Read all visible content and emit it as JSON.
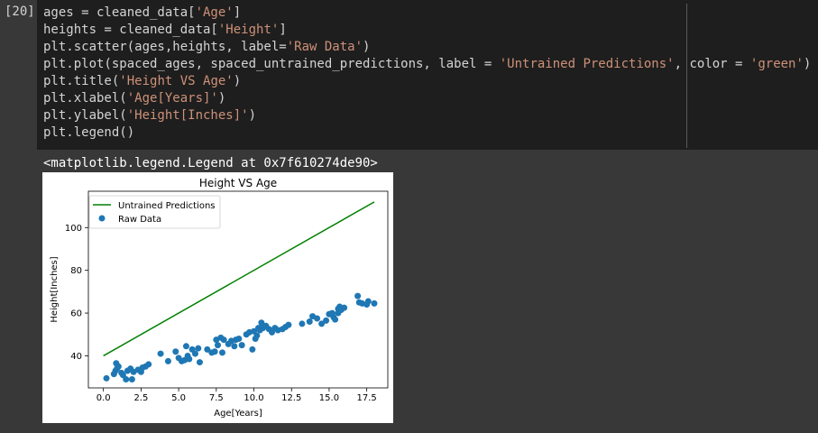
{
  "cell": {
    "prompt": "[20]",
    "code_lines": [
      [
        {
          "t": "ages = cleaned_data["
        },
        {
          "t": "'Age'",
          "s": 1
        },
        {
          "t": "]"
        }
      ],
      [
        {
          "t": "heights = cleaned_data["
        },
        {
          "t": "'Height'",
          "s": 1
        },
        {
          "t": "]"
        }
      ],
      [
        {
          "t": "plt.scatter(ages,heights, label="
        },
        {
          "t": "'Raw Data'",
          "s": 1
        },
        {
          "t": ")"
        }
      ],
      [
        {
          "t": "plt.plot(spaced_ages, spaced_untrained_predictions, label = "
        },
        {
          "t": "'Untrained Predictions'",
          "s": 1
        },
        {
          "t": ", color = "
        },
        {
          "t": "'green'",
          "s": 1
        },
        {
          "t": ")"
        }
      ],
      [
        {
          "t": "plt.title("
        },
        {
          "t": "'Height VS Age'",
          "s": 1
        },
        {
          "t": ")"
        }
      ],
      [
        {
          "t": "plt.xlabel("
        },
        {
          "t": "'Age[Years]'",
          "s": 1
        },
        {
          "t": ")"
        }
      ],
      [
        {
          "t": "plt.ylabel("
        },
        {
          "t": "'Height[Inches]'",
          "s": 1
        },
        {
          "t": ")"
        }
      ],
      [
        {
          "t": "plt.legend()"
        }
      ]
    ]
  },
  "output": {
    "text": "<matplotlib.legend.Legend at 0x7f610274de90>"
  },
  "chart_data": {
    "type": "scatter",
    "title": "Height VS Age",
    "xlabel": "Age[Years]",
    "ylabel": "Height[Inches]",
    "xlim": [
      -1.0,
      18.9
    ],
    "ylim": [
      25,
      117
    ],
    "xticks": [
      0.0,
      2.5,
      5.0,
      7.5,
      10.0,
      12.5,
      15.0,
      17.5
    ],
    "xtick_labels": [
      "0.0",
      "2.5",
      "5.0",
      "7.5",
      "10.0",
      "12.5",
      "15.0",
      "17.5"
    ],
    "yticks": [
      40,
      60,
      80,
      100
    ],
    "ytick_labels": [
      "40",
      "60",
      "80",
      "100"
    ],
    "legend_position": "top-left",
    "line_series": {
      "name": "Untrained Predictions",
      "color": "#008000",
      "x": [
        0.0,
        18.0
      ],
      "y": [
        40,
        112
      ]
    },
    "scatter_series": {
      "name": "Raw Data",
      "color": "#1f77b4",
      "points": [
        [
          0.2,
          29.5
        ],
        [
          0.7,
          31.5
        ],
        [
          0.8,
          33
        ],
        [
          0.9,
          34
        ],
        [
          0.85,
          36.5
        ],
        [
          1.0,
          35
        ],
        [
          1.2,
          32
        ],
        [
          1.3,
          31
        ],
        [
          1.5,
          29
        ],
        [
          1.6,
          33
        ],
        [
          1.8,
          34
        ],
        [
          1.9,
          29
        ],
        [
          2.0,
          32.5
        ],
        [
          2.3,
          33.5
        ],
        [
          2.5,
          32.5
        ],
        [
          2.6,
          34.5
        ],
        [
          2.8,
          35
        ],
        [
          3.0,
          36
        ],
        [
          3.8,
          41
        ],
        [
          4.3,
          37.5
        ],
        [
          4.8,
          42
        ],
        [
          5.0,
          39
        ],
        [
          5.2,
          37.5
        ],
        [
          5.4,
          38
        ],
        [
          5.5,
          44.5
        ],
        [
          5.6,
          40
        ],
        [
          5.7,
          38.5
        ],
        [
          5.9,
          43
        ],
        [
          6.1,
          41
        ],
        [
          6.3,
          43.5
        ],
        [
          6.4,
          37
        ],
        [
          6.9,
          43
        ],
        [
          7.2,
          41.5
        ],
        [
          7.4,
          42
        ],
        [
          7.5,
          47.5
        ],
        [
          7.6,
          45
        ],
        [
          7.8,
          48.5
        ],
        [
          7.9,
          41.5
        ],
        [
          8.0,
          47.5
        ],
        [
          8.3,
          45.5
        ],
        [
          8.5,
          47
        ],
        [
          8.7,
          44.5
        ],
        [
          8.8,
          47.5
        ],
        [
          9.0,
          48
        ],
        [
          9.2,
          45
        ],
        [
          9.5,
          50
        ],
        [
          9.7,
          51
        ],
        [
          9.9,
          43
        ],
        [
          10.0,
          51.5
        ],
        [
          10.1,
          48
        ],
        [
          10.2,
          49.5
        ],
        [
          10.3,
          53
        ],
        [
          10.4,
          52
        ],
        [
          10.5,
          55.5
        ],
        [
          10.6,
          53
        ],
        [
          10.8,
          54
        ],
        [
          11.0,
          52.5
        ],
        [
          11.2,
          51
        ],
        [
          11.4,
          53
        ],
        [
          11.6,
          52
        ],
        [
          11.9,
          52.5
        ],
        [
          12.1,
          53.5
        ],
        [
          12.3,
          54.5
        ],
        [
          13.2,
          55
        ],
        [
          13.7,
          56
        ],
        [
          13.9,
          58.5
        ],
        [
          14.2,
          57.5
        ],
        [
          14.5,
          55
        ],
        [
          14.8,
          56.5
        ],
        [
          15.0,
          59.5
        ],
        [
          15.2,
          60
        ],
        [
          15.3,
          58
        ],
        [
          15.4,
          57
        ],
        [
          15.6,
          60
        ],
        [
          15.6,
          62
        ],
        [
          15.7,
          63
        ],
        [
          15.8,
          61.5
        ],
        [
          16.0,
          62.5
        ],
        [
          16.9,
          68
        ],
        [
          17.0,
          65
        ],
        [
          17.2,
          64.5
        ],
        [
          17.5,
          64
        ],
        [
          17.6,
          65.5
        ],
        [
          18.0,
          64.5
        ]
      ]
    }
  }
}
